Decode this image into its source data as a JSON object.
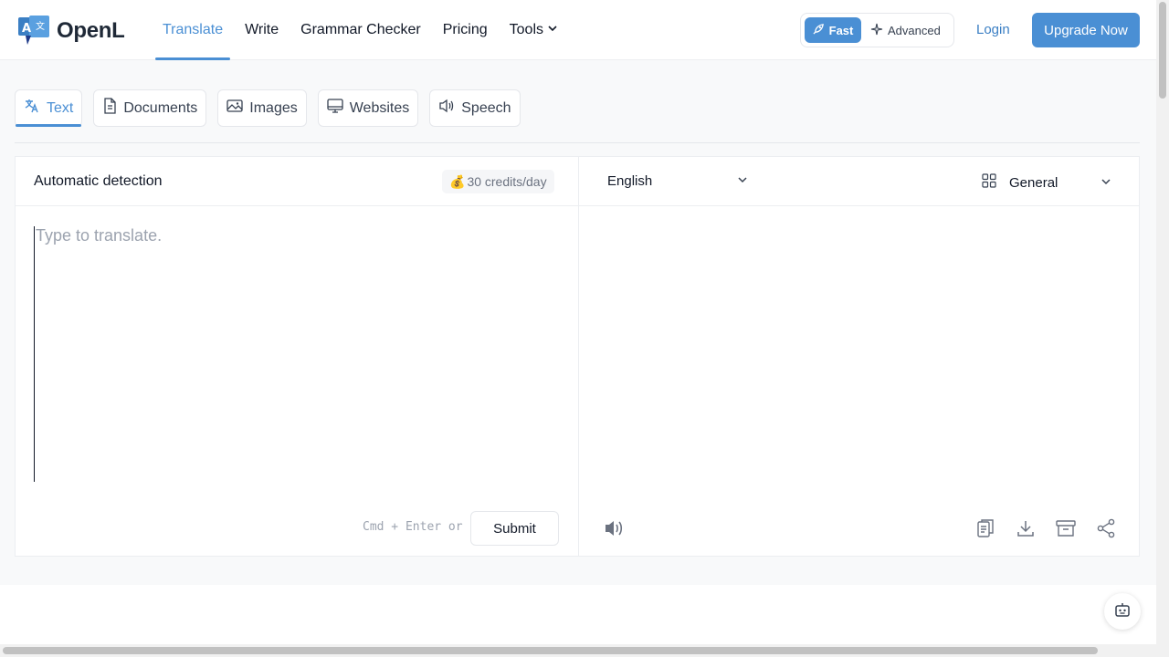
{
  "brand": {
    "name": "OpenL"
  },
  "nav": {
    "items": [
      {
        "label": "Translate",
        "active": true
      },
      {
        "label": "Write"
      },
      {
        "label": "Grammar Checker"
      },
      {
        "label": "Pricing"
      },
      {
        "label": "Tools",
        "has_dropdown": true
      }
    ]
  },
  "mode": {
    "fast_label": "Fast",
    "advanced_label": "Advanced",
    "selected": "Fast"
  },
  "auth": {
    "login_label": "Login",
    "upgrade_label": "Upgrade Now"
  },
  "tabs": [
    {
      "label": "Text",
      "icon": "translate-icon",
      "active": true
    },
    {
      "label": "Documents",
      "icon": "document-icon"
    },
    {
      "label": "Images",
      "icon": "image-icon"
    },
    {
      "label": "Websites",
      "icon": "monitor-icon"
    },
    {
      "label": "Speech",
      "icon": "speaker-icon"
    }
  ],
  "source": {
    "language": "Automatic detection",
    "credits": "30 credits/day",
    "credits_icon": "💰",
    "placeholder": "Type to translate.",
    "value": ""
  },
  "target": {
    "language": "English",
    "domain": "General"
  },
  "actions": {
    "shortcut": "Cmd + Enter or",
    "submit_label": "Submit"
  },
  "colors": {
    "accent": "#4a8fd4",
    "link": "#3b7fc4"
  }
}
